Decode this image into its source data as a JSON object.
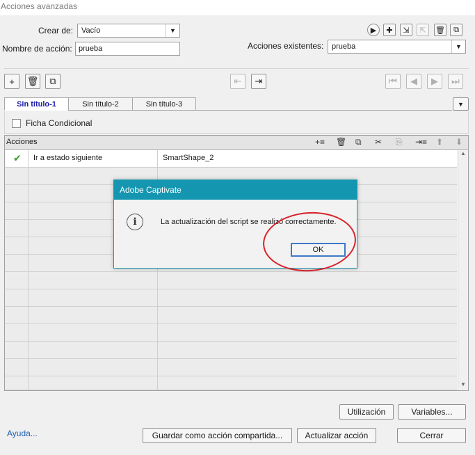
{
  "window": {
    "title": "Acciones avanzadas"
  },
  "form": {
    "crear_de_label": "Crear de:",
    "crear_de_value": "Vacío",
    "nombre_label": "Nombre de acción:",
    "nombre_value": "prueba",
    "existentes_label": "Acciones existentes:",
    "existentes_value": "prueba"
  },
  "tabs": [
    {
      "label": "Sin título-1",
      "active": true
    },
    {
      "label": "Sin título-2",
      "active": false
    },
    {
      "label": "Sin título-3",
      "active": false
    }
  ],
  "condicional": {
    "label": "Ficha Condicional",
    "checked": false
  },
  "grid": {
    "header_label": "Acciones",
    "rows": [
      {
        "status": "checkmark",
        "action": "Ir a estado siguiente",
        "target": "SmartShape_2"
      }
    ]
  },
  "buttons": {
    "utilizacion": "Utilización",
    "variables": "Variables...",
    "ayuda": "Ayuda...",
    "guardar": "Guardar como acción compartida...",
    "actualizar": "Actualizar acción",
    "cerrar": "Cerrar"
  },
  "dialog": {
    "title": "Adobe Captivate",
    "message": "La actualización del script se realizó correctamente.",
    "ok": "OK"
  },
  "colors": {
    "dialog_title_bg": "#1596b0",
    "annotation_red": "#d8222a",
    "tab_active_text": "#1a1aa8"
  },
  "icons": [
    "play-icon",
    "add-icon",
    "folder-icon",
    "delete-icon",
    "copy-icon",
    "cut-icon",
    "info-icon",
    "checkmark-icon"
  ]
}
